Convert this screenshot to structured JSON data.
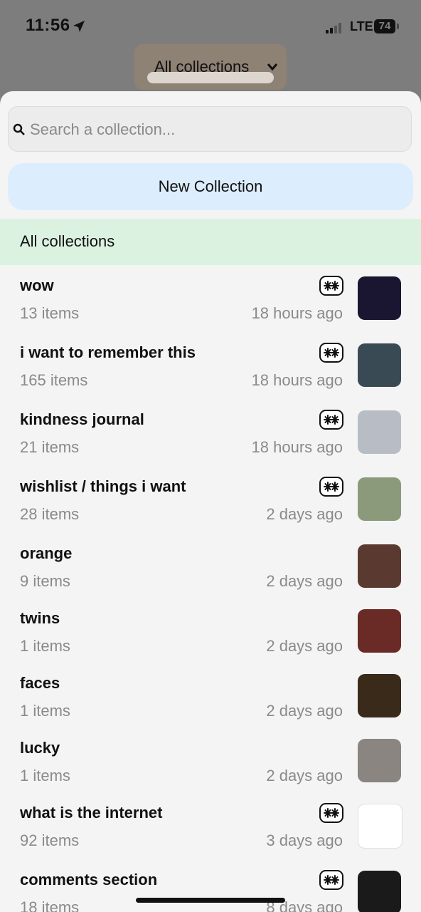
{
  "status_bar": {
    "time": "11:56",
    "network": "LTE",
    "battery": "74"
  },
  "header": {
    "collection_picker_label": "All collections"
  },
  "search": {
    "placeholder": "Search a collection..."
  },
  "new_collection_label": "New Collection",
  "all_collections_label": "All collections",
  "collections": [
    {
      "title": "wow",
      "count": "13 items",
      "time": "18 hours ago",
      "shared": true,
      "thumb_color": "#1a1530"
    },
    {
      "title": "i want to remember this",
      "count": "165 items",
      "time": "18 hours ago",
      "shared": true,
      "thumb_color": "#3a4a55"
    },
    {
      "title": "kindness journal",
      "count": "21 items",
      "time": "18 hours ago",
      "shared": true,
      "thumb_color": "#b8bcc5"
    },
    {
      "title": "wishlist / things i want",
      "count": "28 items",
      "time": "2 days ago",
      "shared": true,
      "thumb_color": "#8a9a7a"
    },
    {
      "title": "orange",
      "count": "9 items",
      "time": "2 days ago",
      "shared": false,
      "thumb_color": "#5a3a30"
    },
    {
      "title": "twins",
      "count": "1 items",
      "time": "2 days ago",
      "shared": false,
      "thumb_color": "#6a2a25"
    },
    {
      "title": "faces",
      "count": "1 items",
      "time": "2 days ago",
      "shared": false,
      "thumb_color": "#3a2a1a"
    },
    {
      "title": "lucky",
      "count": "1 items",
      "time": "2 days ago",
      "shared": false,
      "thumb_color": "#8a8580"
    },
    {
      "title": "what is the internet",
      "count": "92 items",
      "time": "3 days ago",
      "shared": true,
      "thumb_color": "#ffffff"
    },
    {
      "title": "comments section",
      "count": "18 items",
      "time": "8 days ago",
      "shared": true,
      "thumb_color": "#1a1a1a"
    }
  ]
}
